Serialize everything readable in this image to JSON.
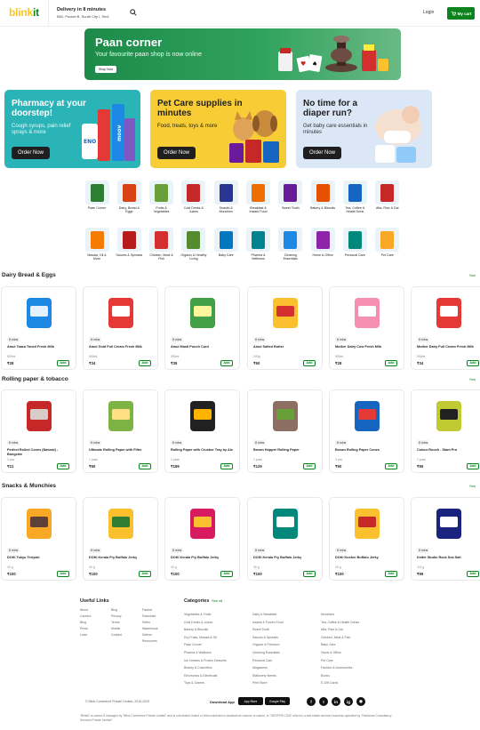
{
  "header": {
    "logo_part1": "blink",
    "logo_part2": "it",
    "delivery_title": "Delivery in 8 minutes",
    "delivery_address": "B62, Pocket B, South City I, Sect",
    "login_label": "Login",
    "cart_label": "My cart"
  },
  "hero": {
    "title": "Paan corner",
    "subtitle": "Your favourite paan shop is now online",
    "button": "Shop Now"
  },
  "promos": [
    {
      "title": "Pharmacy at your doorstep!",
      "subtitle": "Cough syrups, pain relief sprays & more",
      "button": "Order Now"
    },
    {
      "title": "Pet Care supplies in minutes",
      "subtitle": "Food, treats, toys & more",
      "button": "Order Now"
    },
    {
      "title": "No time for a diaper run?",
      "subtitle": "Get baby care essentials in minutes",
      "button": "Order Now"
    }
  ],
  "categories": [
    {
      "label": "Paan Corner",
      "color": "#2e7d32"
    },
    {
      "label": "Dairy, Bread & Eggs",
      "color": "#d84315"
    },
    {
      "label": "Fruits & Vegetables",
      "color": "#689f38"
    },
    {
      "label": "Cold Drinks & Juices",
      "color": "#c62828"
    },
    {
      "label": "Snacks & Munchies",
      "color": "#283593"
    },
    {
      "label": "Breakfast & Instant Food",
      "color": "#ef6c00"
    },
    {
      "label": "Sweet Tooth",
      "color": "#6a1b9a"
    },
    {
      "label": "Bakery & Biscuits",
      "color": "#e65100"
    },
    {
      "label": "Tea, Coffee & Health Drink",
      "color": "#1565c0"
    },
    {
      "label": "Atta, Rice & Dal",
      "color": "#c62828"
    },
    {
      "label": "Masala, Oil & More",
      "color": "#f57c00"
    },
    {
      "label": "Sauces & Spreads",
      "color": "#b71c1c"
    },
    {
      "label": "Chicken, Meat & Fish",
      "color": "#d32f2f"
    },
    {
      "label": "Organic & Healthy Living",
      "color": "#558b2f"
    },
    {
      "label": "Baby Care",
      "color": "#0277bd"
    },
    {
      "label": "Pharma & Wellness",
      "color": "#00838f"
    },
    {
      "label": "Cleaning Essentials",
      "color": "#1e88e5"
    },
    {
      "label": "Home & Office",
      "color": "#8e24aa"
    },
    {
      "label": "Personal Care",
      "color": "#00897b"
    },
    {
      "label": "Pet Care",
      "color": "#f9a825"
    }
  ],
  "sections": [
    {
      "title": "Dairy Bread & Eggs",
      "see_all": "See",
      "products": [
        {
          "name": "Amul Taaza Toned Fresh Milk",
          "qty": "500ml",
          "price": "₹28",
          "time": "8 mins",
          "color": "#1e88e5",
          "accent": "#e3f2fd"
        },
        {
          "name": "Amul Gold Full Cream Fresh Milk",
          "qty": "500ml",
          "price": "₹34",
          "time": "8 mins",
          "color": "#e53935",
          "accent": "#ffffff"
        },
        {
          "name": "Amul Masti Pouch Curd",
          "qty": "390ml",
          "price": "₹35",
          "time": "8 mins",
          "color": "#43a047",
          "accent": "#fff59d"
        },
        {
          "name": "Amul Salted Butter",
          "qty": "100g",
          "price": "₹60",
          "time": "8 mins",
          "color": "#fbc02d",
          "accent": "#d32f2f"
        },
        {
          "name": "Mother Dairy Cow Fresh Milk",
          "qty": "500ml",
          "price": "₹28",
          "time": "8 mins",
          "color": "#f48fb1",
          "accent": "#ffffff"
        },
        {
          "name": "Mother Dairy Full Cream Fresh Milk",
          "qty": "500ml",
          "price": "₹34",
          "time": "8 mins",
          "color": "#e53935",
          "accent": "#ffffff"
        }
      ]
    },
    {
      "title": "Rolling paper & tobacco",
      "see_all": "See",
      "products": [
        {
          "name": "Perfect Rolled Cones (Natural) - Bongchie",
          "qty": "3 pcs",
          "price": "₹21",
          "time": "8 mins",
          "color": "#c62828",
          "accent": "#d7ccc8"
        },
        {
          "name": "Ultimate Rolling Paper with Filter",
          "qty": "1 pack",
          "price": "₹60",
          "time": "8 mins",
          "color": "#7cb342",
          "accent": "#ffe082"
        },
        {
          "name": "Rolling Paper with Crusher Tray by Aix",
          "qty": "1 pack",
          "price": "₹189",
          "time": "8 mins",
          "color": "#212121",
          "accent": "#ffb300"
        },
        {
          "name": "Brown Hopper Rolling Paper",
          "qty": "1 pack",
          "price": "₹129",
          "time": "8 mins",
          "color": "#8d6e63",
          "accent": "#689f38"
        },
        {
          "name": "Brown Rolling Paper Cones",
          "qty": "3 pcs",
          "price": "₹50",
          "time": "8 mins",
          "color": "#1565c0",
          "accent": "#e53935"
        },
        {
          "name": "Colour Rooch - Slant Pro",
          "qty": "1 pack",
          "price": "₹55",
          "time": "8 mins",
          "color": "#c0ca33",
          "accent": "#212121"
        }
      ]
    },
    {
      "title": "Snacks & Munchies",
      "see_all": "See",
      "products": [
        {
          "name": "DOKi Tokyo Teriyaki",
          "qty": "30 g",
          "price": "₹100",
          "time": "8 mins",
          "color": "#f9a825",
          "accent": "#5d4037"
        },
        {
          "name": "DOKi Kerala Fry Buffalo Jerky",
          "qty": "30 g",
          "price": "₹100",
          "time": "8 mins",
          "color": "#fbc02d",
          "accent": "#2e7d32"
        },
        {
          "name": "DOKi Kerala Fry Buffalo Jerky",
          "qty": "30 g",
          "price": "₹100",
          "time": "8 mins",
          "color": "#d81b60",
          "accent": "#fbc02d"
        },
        {
          "name": "DOKi Kerala Fry Buffalo Jerky",
          "qty": "30 g",
          "price": "₹100",
          "time": "8 mins",
          "color": "#00897b",
          "accent": "#ffffff"
        },
        {
          "name": "DOKi Kosher Buffalo Jerky",
          "qty": "30 g",
          "price": "₹100",
          "time": "8 mins",
          "color": "#fbc02d",
          "accent": "#c62828"
        },
        {
          "name": "Kettle Studio Rock Sea Salt",
          "qty": "113 g",
          "price": "₹99",
          "time": "8 mins",
          "color": "#1a237e",
          "accent": "#ffffff"
        }
      ]
    }
  ],
  "footer": {
    "useful_links_title": "Useful Links",
    "useful_links": [
      [
        "About",
        "Blog",
        "Partner"
      ],
      [
        "Careers",
        "Privacy",
        "Franchise"
      ],
      [
        "Blog",
        "Terms",
        "Seller"
      ],
      [
        "Press",
        "Mobile",
        "Warehouse"
      ],
      [
        "Lead",
        "Contact",
        "Deliver"
      ],
      [
        "",
        "",
        "Resources"
      ]
    ],
    "categories_title": "Categories",
    "see_all": "See all",
    "categories": [
      [
        "Vegetables & Fruits",
        "Dairy & Breakfast",
        "Munchies"
      ],
      [
        "Cold Drinks & Juices",
        "Instant & Frozen Food",
        "Tea, Coffee & Health Drinks"
      ],
      [
        "Bakery & Biscuits",
        "Sweet Tooth",
        "Atta, Rice & Dal"
      ],
      [
        "Dry Fruits, Masala & Oil",
        "Sauces & Spreads",
        "Chicken, Meat & Fish"
      ],
      [
        "Paan Corner",
        "Organic & Premium",
        "Baby Care"
      ],
      [
        "Pharma & Wellness",
        "Cleaning Essentials",
        "Home & Office"
      ],
      [
        "Ice Creams & Frozen Desserts",
        "Personal Care",
        "Pet Care"
      ],
      [
        "Beauty & Cosmetics",
        "Magazines",
        "Fashion & Accessories"
      ],
      [
        "Electronics & Electricals",
        "Stationery Needs",
        "Books"
      ],
      [
        "Toys & Games",
        "Print Store",
        "E-Gift Cards"
      ]
    ],
    "copyright": "© Blink Commerce Private Limited, 2016-2025",
    "download_label": "Download App",
    "app_store": "App Store",
    "play_store": "Google Play",
    "social": [
      "f",
      "t",
      "in",
      "ig",
      "◉"
    ],
    "disclaimer": "\"Blinkit\" is owned & managed by \"Blink Commerce Private Limited\" and is not related, linked or interconnected in whatsoever manner or nature, to \"GROFFR.COM\" which is a real estate services business operated by \"Redstone Consultancy Services Private Limited\"."
  }
}
